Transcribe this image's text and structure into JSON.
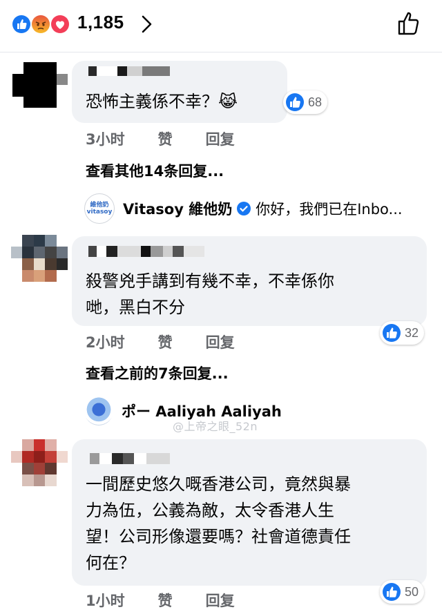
{
  "header": {
    "reaction_count": "1,185",
    "reactions": [
      "like-icon",
      "angry-icon",
      "love-icon"
    ]
  },
  "comments": [
    {
      "text_lines": [
        "恐怖主義係不幸？😹"
      ],
      "likes": "68",
      "time": "3小时",
      "like_label": "赞",
      "reply_label": "回复",
      "more_replies": "查看其他14条回复..."
    },
    {
      "text_lines": [
        "殺警兇手講到有幾不幸，不幸係你",
        "哋，黑白不分"
      ],
      "likes": "32",
      "time": "2小时",
      "like_label": "赞",
      "reply_label": "回复",
      "more_replies": "查看之前的7条回复..."
    },
    {
      "text_lines": [
        "一間歷史悠久嘅香港公司，竟然與暴",
        "力為伍，公義為敵，太令香港人生",
        "望！公司形像還要嗎？社會道德責任",
        "何在？"
      ],
      "likes": "50",
      "time": "1小时",
      "like_label": "赞",
      "reply_label": "回复"
    }
  ],
  "replies": [
    {
      "name": "Vitasoy 維他奶",
      "preview": "你好，我們已在Inbo...",
      "logo_text": "維他奶 vitasoy"
    },
    {
      "name": "ポー Aaliyah Aaliyah"
    }
  ],
  "watermark": "@上帝之眼_52n",
  "colors": {
    "bubble": "#f0f2f5",
    "like_blue": "#1877f2",
    "meta_gray": "#65676b"
  }
}
